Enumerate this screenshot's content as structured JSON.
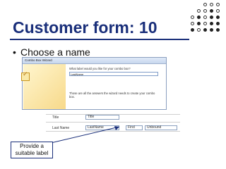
{
  "slide": {
    "title": "Customer form: 10",
    "bullet": "Choose a name",
    "callout": "Provide a suitable label"
  },
  "wizard": {
    "window_title": "Combo Box Wizard",
    "question": "What label would you like for your combo box?",
    "input_value": "LastName",
    "note": "Those are all the answers the wizard needs to create your combo box."
  },
  "design_grid": {
    "row1": {
      "label": "Title",
      "box": "Title"
    },
    "row2": {
      "label": "Last Name",
      "box": "LastName",
      "label2": "Find",
      "box2": "Unbound"
    }
  },
  "colors": {
    "title": "#1a2f7a",
    "accent": "#1a2f7a"
  }
}
